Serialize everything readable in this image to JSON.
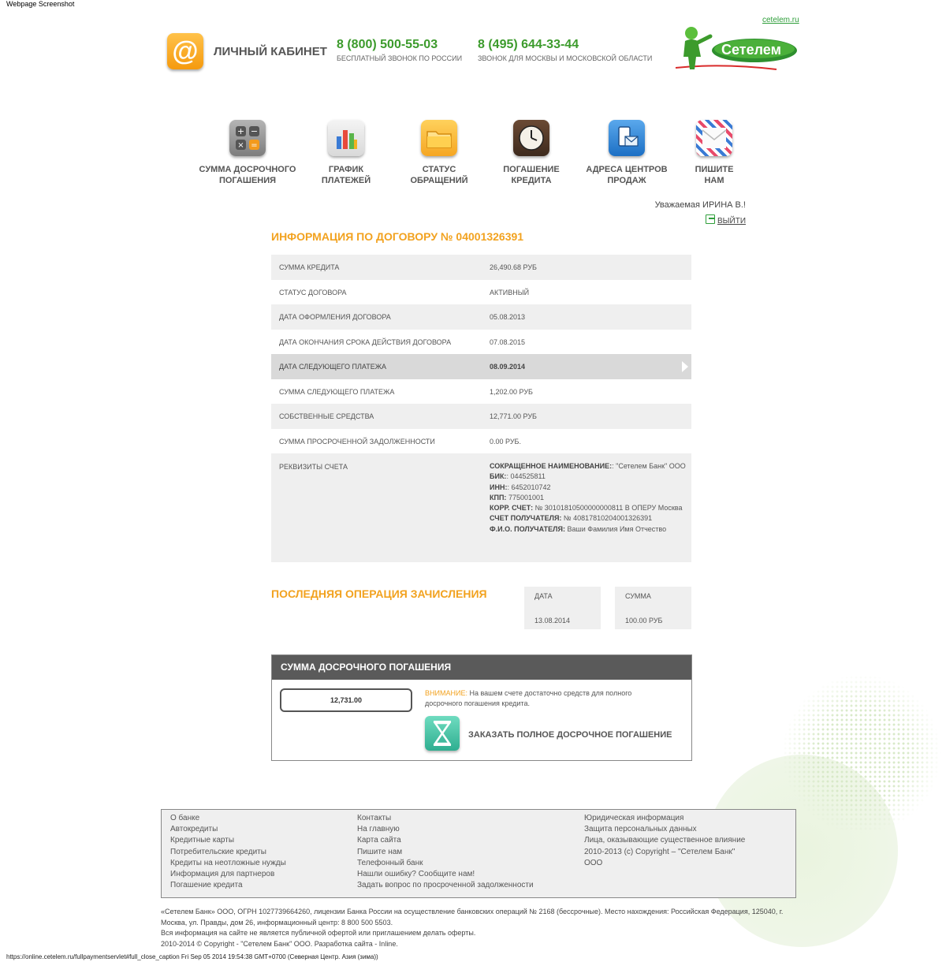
{
  "caption": "Webpage Screenshot",
  "header": {
    "site_link": "cetelem.ru",
    "cabinet_title": "ЛИЧНЫЙ КАБИНЕТ",
    "phone1": "8 (800) 500-55-03",
    "phone1_note": "БЕСПЛАТНЫЙ ЗВОНОК ПО РОССИИ",
    "phone2": "8 (495) 644-33-44",
    "phone2_note": "ЗВОНОК ДЛЯ МОСКВЫ И МОСКОВСКОЙ ОБЛАСТИ",
    "logo_text": "Сетелем"
  },
  "nav": [
    {
      "line1": "СУММА ДОСРОЧНОГО",
      "line2": "ПОГАШЕНИЯ",
      "icon": "calculator-icon"
    },
    {
      "line1": "ГРАФИК",
      "line2": "ПЛАТЕЖЕЙ",
      "icon": "chart-icon"
    },
    {
      "line1": "СТАТУС",
      "line2": "ОБРАЩЕНИЙ",
      "icon": "folder-icon"
    },
    {
      "line1": "ПОГАШЕНИЕ",
      "line2": "КРЕДИТА",
      "icon": "clock-icon"
    },
    {
      "line1": "АДРЕСА ЦЕНТРОВ",
      "line2": "ПРОДАЖ",
      "icon": "phone-map-icon"
    },
    {
      "line1": "ПИШИТЕ",
      "line2": "НАМ",
      "icon": "envelope-icon"
    }
  ],
  "user": {
    "greeting": "Уважаемая ИРИНА В.!",
    "logout": "ВЫЙТИ"
  },
  "contract": {
    "title": "ИНФОРМАЦИЯ ПО ДОГОВОРУ № 04001326391",
    "rows": [
      {
        "label": "СУММА КРЕДИТА",
        "value": "26,490.68 РУБ"
      },
      {
        "label": "СТАТУС ДОГОВОРА",
        "value": "АКТИВНЫЙ"
      },
      {
        "label": "ДАТА ОФОРМЛЕНИЯ ДОГОВОРА",
        "value": "05.08.2013"
      },
      {
        "label": "ДАТА ОКОНЧАНИЯ СРОКА ДЕЙСТВИЯ ДОГОВОРА",
        "value": "07.08.2015"
      },
      {
        "label": "ДАТА СЛЕДУЮЩЕГО ПЛАТЕЖА",
        "value": "08.09.2014"
      },
      {
        "label": "СУММА СЛЕДУЮЩЕГО ПЛАТЕЖА",
        "value": "1,202.00 РУБ"
      },
      {
        "label": "СОБСТВЕННЫЕ СРЕДСТВА",
        "value": "12,771.00 РУБ"
      },
      {
        "label": "СУММА ПРОСРОЧЕННОЙ ЗАДОЛЖЕННОСТИ",
        "value": "0.00 РУБ."
      }
    ],
    "requisites": {
      "label": "РЕКВИЗИТЫ СЧЕТА",
      "short_name_label": "СОКРАЩЕННОЕ НАИМЕНОВАНИЕ:",
      "short_name": ": \"Сетелем Банк\" ООО",
      "bik_label": "БИК:",
      "bik": ": 044525811",
      "inn_label": "ИНН:",
      "inn": ": 6452010742",
      "kpp_label": "КПП:",
      "kpp": " 775001001",
      "corr_label": "КОРР. СЧЕТ:",
      "corr": " № 30101810500000000811 В ОПЕРУ Москва",
      "account_label": "СЧЕТ ПОЛУЧАТЕЛЯ:",
      "account": " № 40817810204001326391",
      "fio_label": "Ф.И.О. ПОЛУЧАТЕЛЯ:",
      "fio": " Ваши Фамилия Имя Отчество"
    }
  },
  "last_op": {
    "title": "ПОСЛЕДНЯЯ ОПЕРАЦИЯ ЗАЧИСЛЕНИЯ",
    "date_label": "ДАТА",
    "date": "13.08.2014",
    "sum_label": "СУММА",
    "sum": "100.00 РУБ"
  },
  "early": {
    "title": "СУММА ДОСРОЧНОГО ПОГАШЕНИЯ",
    "amount": "12,731.00",
    "warn_label": "ВНИМАНИЕ:",
    "warn_text": " На вашем счете достаточно средств для полного досрочного погашения кредита.",
    "order_label": "ЗАКАЗАТЬ ПОЛНОЕ ДОСРОЧНОЕ ПОГАШЕНИЕ"
  },
  "footer": {
    "col1": [
      "О банке",
      "Автокредиты",
      "Кредитные карты",
      "Потребительские кредиты",
      "Кредиты на неотложные нужды",
      "Информация для партнеров",
      "Погашение кредита"
    ],
    "col2": [
      "Контакты",
      "На главную",
      "Карта сайта",
      "Пишите нам",
      "Телефонный банк",
      "Нашли ошибку? Сообщите нам!",
      "Задать вопрос по просроченной задолженности"
    ],
    "col3": [
      "Юридическая информация",
      "Защита персональных данных",
      "Лица, оказывающие существенное влияние",
      "2010-2013 (с) Copyright – \"Сетелем Банк\"",
      "ООО"
    ]
  },
  "legal": {
    "line1": "«Сетелем Банк» ООО, ОГРН 1027739664260, лицензии Банка России на осуществление банковских операций № 2168 (бессрочные). Место нахождения: Российская Федерация, 125040, г. Москва, ул. Правды, дом 26, информационный центр: 8 800 500 5503.",
    "line2": "Вся информация на сайте не является публичной офертой или приглашением делать оферты.",
    "line3": "2010-2014 © Copyright - \"Сетелем Банк\" ООО. Разработка сайта - Inline."
  },
  "status_bar": "https://online.cetelem.ru/fullpaymentservlet#full_close_caption Fri Sep 05 2014 19:54:38 GMT+0700 (Северная Центр. Азия (зима))",
  "colors": {
    "brand_green": "#3c9b2c",
    "accent_orange": "#f2a21f",
    "dark_header": "#5a5a5a"
  }
}
